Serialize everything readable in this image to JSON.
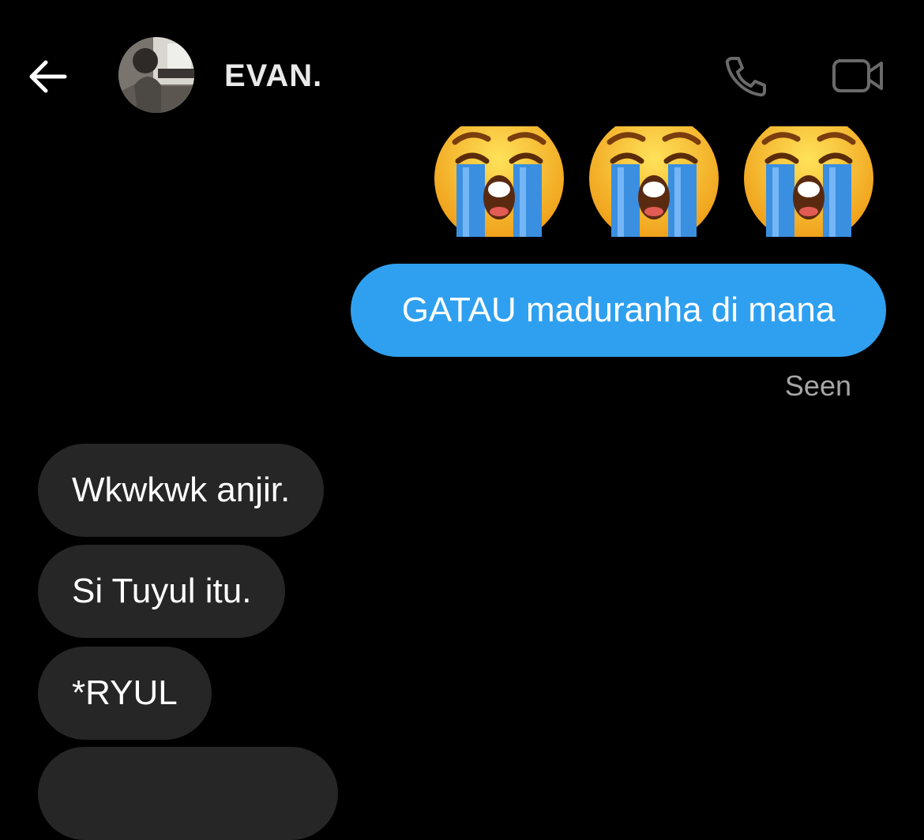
{
  "header": {
    "contact_name": "EVAN.",
    "back_icon": "arrow-left-icon",
    "call_icon": "phone-icon",
    "video_icon": "video-camera-icon"
  },
  "messages": {
    "outgoing_emojis": [
      "😭",
      "😭",
      "😭"
    ],
    "outgoing_text": "GATAU maduranha di mana",
    "seen_label": "Seen",
    "incoming": [
      "Wkwkwk anjir.",
      "Si Tuyul itu.",
      "*RYUL"
    ]
  },
  "colors": {
    "background": "#000000",
    "outgoing_bubble": "#2fa0f0",
    "incoming_bubble": "#262626",
    "seen_text": "#a6a6a6"
  }
}
